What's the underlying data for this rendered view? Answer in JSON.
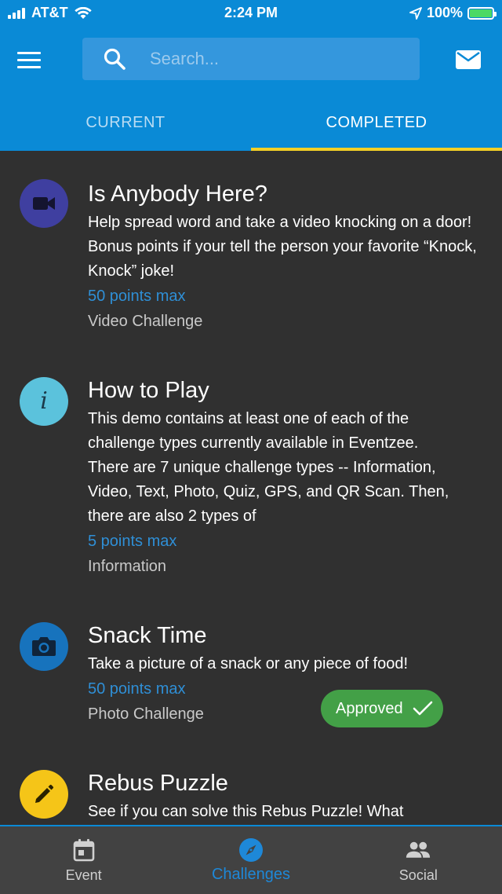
{
  "status_bar": {
    "carrier": "AT&T",
    "time": "2:24 PM",
    "battery": "100%"
  },
  "header": {
    "search": {
      "placeholder": "Search..."
    },
    "icons": {
      "menu": "hamburger-menu-icon",
      "search": "search-icon",
      "mail": "envelope-icon"
    },
    "tabs": [
      {
        "label": "CURRENT",
        "active": false
      },
      {
        "label": "COMPLETED",
        "active": true
      }
    ]
  },
  "colors": {
    "primary": "#0a8ad6",
    "tab_indicator": "#f3d027",
    "background": "#303030",
    "points": "#2f8fd6",
    "approved": "#43a047"
  },
  "challenges": [
    {
      "title": "Is Anybody Here?",
      "description": "Help spread word and take a video knocking on a door! Bonus points if your tell the person your favorite “Knock, Knock” joke!",
      "points": "50 points max",
      "type": "Video Challenge",
      "icon": "video-camera-icon",
      "icon_color": "#3f3fa0"
    },
    {
      "title": "How to Play",
      "description": "This demo contains at least one of each of the challenge types currently available in Eventzee. There are 7 unique challenge types -- Information, Video, Text, Photo, Quiz, GPS, and QR Scan. Then, there are also 2 types of",
      "points": "5 points max",
      "type": "Information",
      "icon": "info-icon",
      "icon_color": "#5bc2dc"
    },
    {
      "title": "Snack Time",
      "description": "Take a picture of a snack or any piece of food!",
      "points": "50 points max",
      "type": "Photo Challenge",
      "icon": "camera-icon",
      "icon_color": "#1773bd",
      "status": "Approved"
    },
    {
      "title": "Rebus Puzzle",
      "description": "See if you can solve this Rebus Puzzle! What",
      "icon": "pencil-icon",
      "icon_color": "#f5c518"
    }
  ],
  "bottom_nav": [
    {
      "label": "Event",
      "icon": "calendar-icon",
      "active": false
    },
    {
      "label": "Challenges",
      "icon": "compass-icon",
      "active": true
    },
    {
      "label": "Social",
      "icon": "people-icon",
      "active": false
    }
  ]
}
